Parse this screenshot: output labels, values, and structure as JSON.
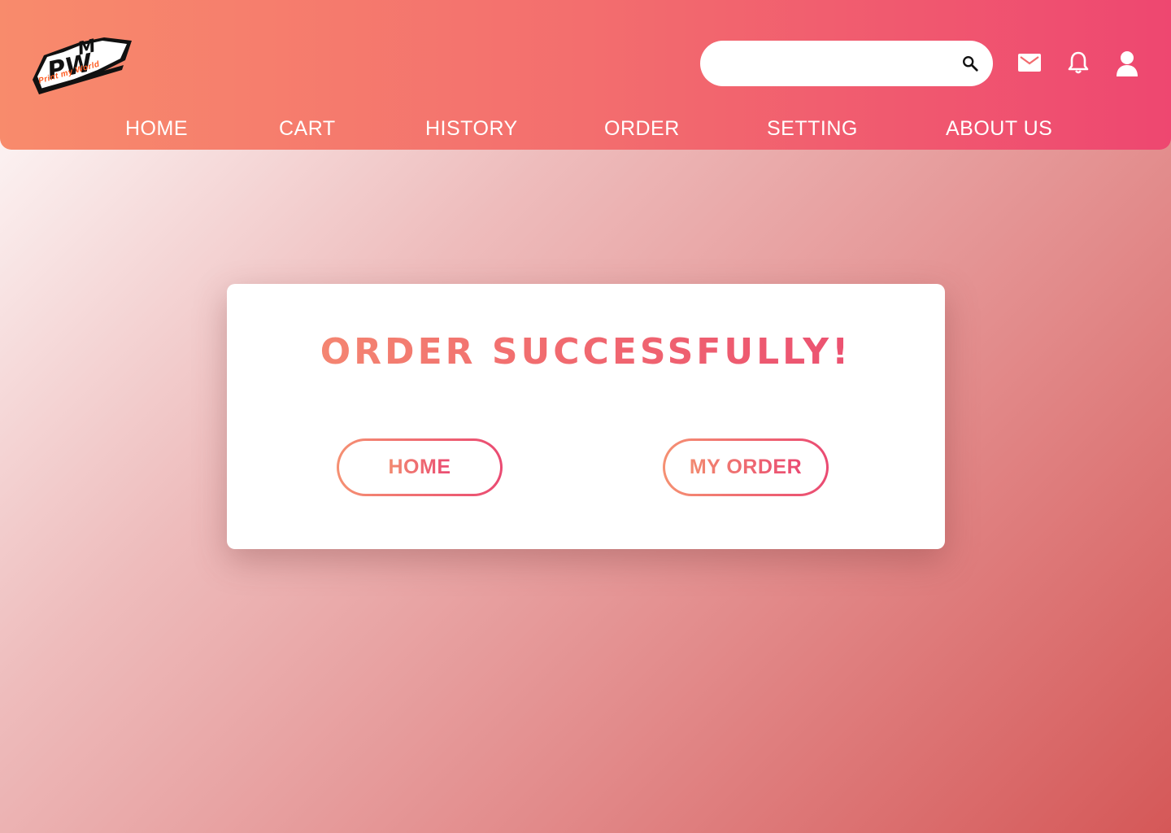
{
  "header": {
    "logo": {
      "text": "Print my World",
      "icon": "pmw-logo-icon"
    },
    "search": {
      "placeholder": "",
      "value": "",
      "icon": "search-icon"
    },
    "icons": [
      "mail-icon",
      "bell-icon",
      "user-icon"
    ],
    "nav": [
      {
        "label": "HOME"
      },
      {
        "label": "CART"
      },
      {
        "label": "HISTORY"
      },
      {
        "label": "ORDER"
      },
      {
        "label": "SETTING"
      },
      {
        "label": "ABOUT US"
      }
    ]
  },
  "card": {
    "title": "ORDER SUCCESSFULLY!",
    "buttons": [
      {
        "label": "HOME"
      },
      {
        "label": "MY ORDER"
      }
    ]
  },
  "colors": {
    "header_start": "#f88b6c",
    "header_end": "#ee4770",
    "accent_start": "#f59072",
    "accent_end": "#ea4a72",
    "card_bg": "#ffffff",
    "nav_text": "#ffffff"
  }
}
